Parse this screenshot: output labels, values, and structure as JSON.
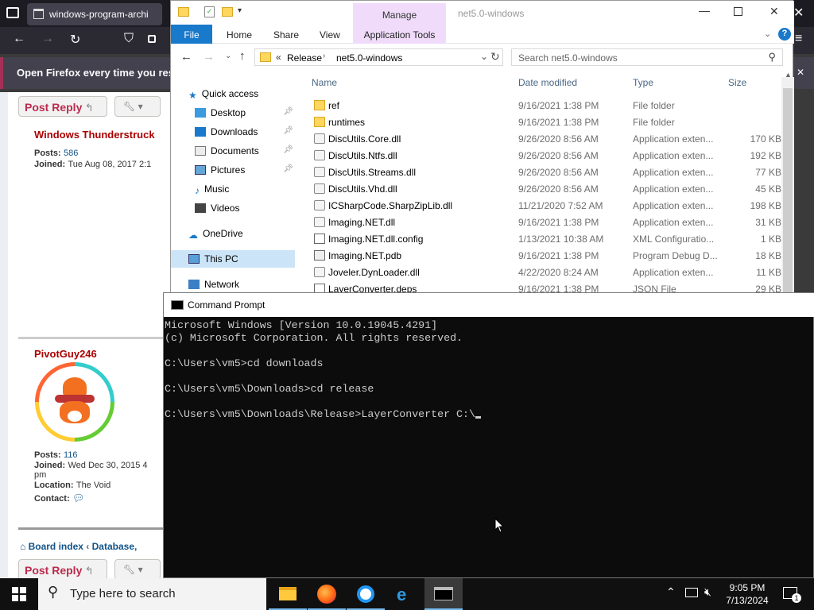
{
  "firefox": {
    "tab_title": "windows-program-archi",
    "notification": "Open Firefox every time you resta"
  },
  "forum": {
    "post_reply": "Post Reply",
    "user1": {
      "name": "Windows Thunderstruck",
      "posts_label": "Posts:",
      "posts": "586",
      "joined_label": "Joined:",
      "joined": "Tue Aug 08, 2017 2:1"
    },
    "user2": {
      "name": "PivotGuy246",
      "posts_label": "Posts:",
      "posts": "116",
      "joined_label": "Joined:",
      "joined": "Wed Dec 30, 2015 4",
      "joined_cont": "pm",
      "location_label": "Location:",
      "location": "The Void",
      "contact_label": "Contact:"
    },
    "breadcrumb": {
      "board": "Board index",
      "sep": "‹",
      "database": "Database,"
    }
  },
  "explorer": {
    "window_title": "net5.0-windows",
    "manage_label": "Manage",
    "ribbon_tabs": [
      "File",
      "Home",
      "Share",
      "View",
      "Application Tools"
    ],
    "breadcrumb_prefix": "«",
    "breadcrumb": [
      "Release",
      "net5.0-windows"
    ],
    "search_placeholder": "Search net5.0-windows",
    "nav": [
      {
        "label": "Quick access",
        "icon": "star-icon"
      },
      {
        "label": "Desktop",
        "icon": "desktop-folder-icon",
        "pinned": true
      },
      {
        "label": "Downloads",
        "icon": "downloads-folder-icon",
        "pinned": true
      },
      {
        "label": "Documents",
        "icon": "documents-folder-icon",
        "pinned": true
      },
      {
        "label": "Pictures",
        "icon": "pictures-folder-icon",
        "pinned": true
      },
      {
        "label": "Music",
        "icon": "music-folder-icon"
      },
      {
        "label": "Videos",
        "icon": "videos-folder-icon"
      },
      {
        "label": "OneDrive",
        "icon": "cloud-icon"
      },
      {
        "label": "This PC",
        "icon": "computer-icon",
        "selected": true
      },
      {
        "label": "Network",
        "icon": "network-icon"
      }
    ],
    "columns": {
      "name": "Name",
      "date": "Date modified",
      "type": "Type",
      "size": "Size"
    },
    "files": [
      {
        "name": "ref",
        "date": "9/16/2021 1:38 PM",
        "type": "File folder",
        "size": "",
        "icon": "folder"
      },
      {
        "name": "runtimes",
        "date": "9/16/2021 1:38 PM",
        "type": "File folder",
        "size": "",
        "icon": "folder"
      },
      {
        "name": "DiscUtils.Core.dll",
        "date": "9/26/2020 8:56 AM",
        "type": "Application exten...",
        "size": "170 KB",
        "icon": "dll"
      },
      {
        "name": "DiscUtils.Ntfs.dll",
        "date": "9/26/2020 8:56 AM",
        "type": "Application exten...",
        "size": "192 KB",
        "icon": "dll"
      },
      {
        "name": "DiscUtils.Streams.dll",
        "date": "9/26/2020 8:56 AM",
        "type": "Application exten...",
        "size": "77 KB",
        "icon": "dll"
      },
      {
        "name": "DiscUtils.Vhd.dll",
        "date": "9/26/2020 8:56 AM",
        "type": "Application exten...",
        "size": "45 KB",
        "icon": "dll"
      },
      {
        "name": "ICSharpCode.SharpZipLib.dll",
        "date": "11/21/2020 7:52 AM",
        "type": "Application exten...",
        "size": "198 KB",
        "icon": "dll"
      },
      {
        "name": "Imaging.NET.dll",
        "date": "9/16/2021 1:38 PM",
        "type": "Application exten...",
        "size": "31 KB",
        "icon": "dll"
      },
      {
        "name": "Imaging.NET.dll.config",
        "date": "1/13/2021 10:38 AM",
        "type": "XML Configuratio...",
        "size": "1 KB",
        "icon": "config"
      },
      {
        "name": "Imaging.NET.pdb",
        "date": "9/16/2021 1:38 PM",
        "type": "Program Debug D...",
        "size": "18 KB",
        "icon": "pdb"
      },
      {
        "name": "Joveler.DynLoader.dll",
        "date": "4/22/2020 8:24 AM",
        "type": "Application exten...",
        "size": "11 KB",
        "icon": "dll"
      },
      {
        "name": "LayerConverter.deps",
        "date": "9/16/2021 1:38 PM",
        "type": "JSON File",
        "size": "29 KB",
        "icon": "json"
      }
    ]
  },
  "cmd": {
    "title": "Command Prompt",
    "lines": [
      "Microsoft Windows [Version 10.0.19045.4291]",
      "(c) Microsoft Corporation. All rights reserved.",
      "",
      "C:\\Users\\vm5>cd downloads",
      "",
      "C:\\Users\\vm5\\Downloads>cd release",
      "",
      "C:\\Users\\vm5\\Downloads\\Release>LayerConverter C:\\"
    ]
  },
  "taskbar": {
    "search_placeholder": "Type here to search",
    "time": "9:05 PM",
    "date": "7/13/2024",
    "notification_count": "1"
  }
}
